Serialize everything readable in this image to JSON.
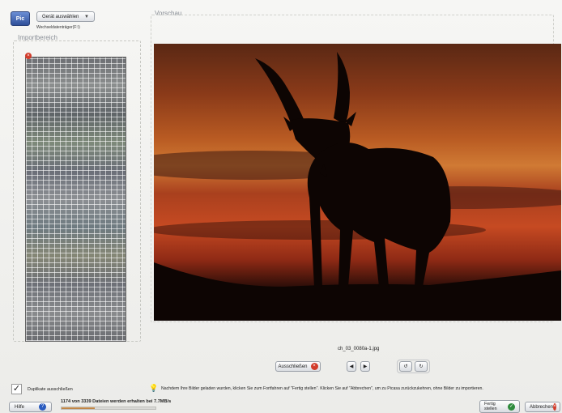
{
  "header": {
    "logo_text": "Pic",
    "device_select": "Gerät auswählen",
    "drive_label": "Wechseldatenträger(F:\\)"
  },
  "import_area": {
    "title": "Importbereich"
  },
  "preview": {
    "title": "Vorschau",
    "filename": "ch_03_0080a-1.jpg"
  },
  "controls": {
    "exclude_label": "Ausschließen",
    "exclude_icon": "×",
    "prev_icon": "◀",
    "next_icon": "▶",
    "rotate_left_icon": "↺",
    "rotate_right_icon": "↻"
  },
  "footer": {
    "duplicates_label": "Duplikate ausschließen",
    "duplicates_checked": "✓",
    "hint_icon": "💡",
    "hint": "Nachdem Ihre Bilder geladen wurden, klicken Sie zum Fortfahren auf \"Fertig stellen\". Klicken Sie auf \"Abbrechen\", um zu Picasa zurückzukehren, ohne Bilder zu importieren.",
    "help_label": "Hilfe",
    "help_icon": "?",
    "progress_text": "1174 von 3339 Dateien werden erhalten bei 7.7MB/s",
    "progress_fraction": 0.35,
    "finish_label_1": "Fertig",
    "finish_label_2": "stellen",
    "finish_icon": "✓",
    "cancel_label": "Abbrechen",
    "cancel_icon": "×"
  }
}
